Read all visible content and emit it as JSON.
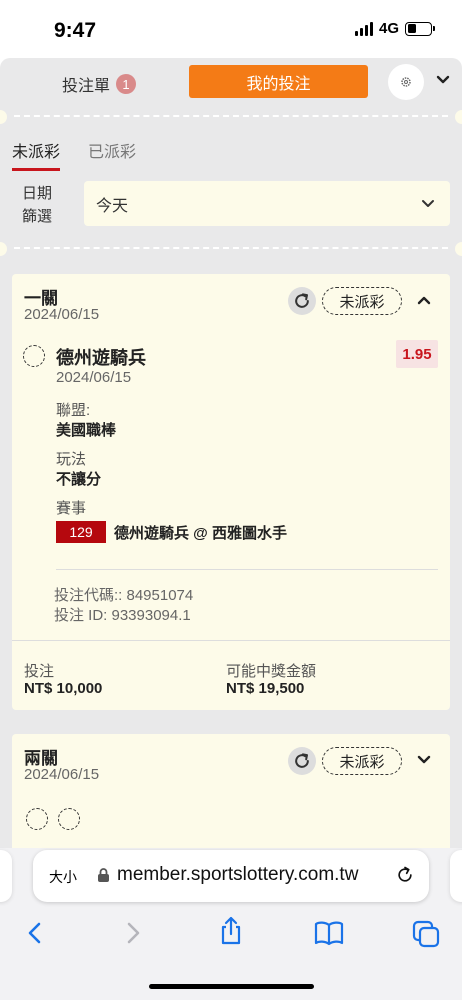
{
  "status_bar": {
    "time": "9:47",
    "network": "4G"
  },
  "header": {
    "betslip_label": "投注單",
    "betslip_count": "1",
    "mybets_label": "我的投注"
  },
  "tabs": [
    {
      "label": "未派彩",
      "active": true
    },
    {
      "label": "已派彩",
      "active": false
    }
  ],
  "date_filter": {
    "label": "日期篩選",
    "value": "今天"
  },
  "bets": [
    {
      "title": "一關",
      "date": "2024/06/15",
      "status": "未派彩",
      "selection": {
        "team": "德州遊騎兵",
        "date": "2024/06/15",
        "odds": "1.95",
        "league_label": "聯盟:",
        "league": "美國職棒",
        "market_label": "玩法",
        "market": "不讓分",
        "event_label": "賽事",
        "event_number": "129",
        "event_name": "德州遊騎兵 @ 西雅圖水手"
      },
      "bet_code": "投注代碼:: 84951074",
      "bet_id": "投注 ID: 93393094.1",
      "stake_label": "投注",
      "stake": "NT$ 10,000",
      "payout_label": "可能中獎金額",
      "payout": "NT$ 19,500"
    },
    {
      "title": "兩關",
      "date": "2024/06/15",
      "status": "未派彩"
    }
  ],
  "browser": {
    "text_size_label": "大小",
    "url": "member.sportslottery.com.tw"
  },
  "colors": {
    "accent": "#f47b16",
    "brand_red": "#c8161d",
    "card_bg": "#fdfbe9",
    "app_bg": "#e9e9ea"
  }
}
